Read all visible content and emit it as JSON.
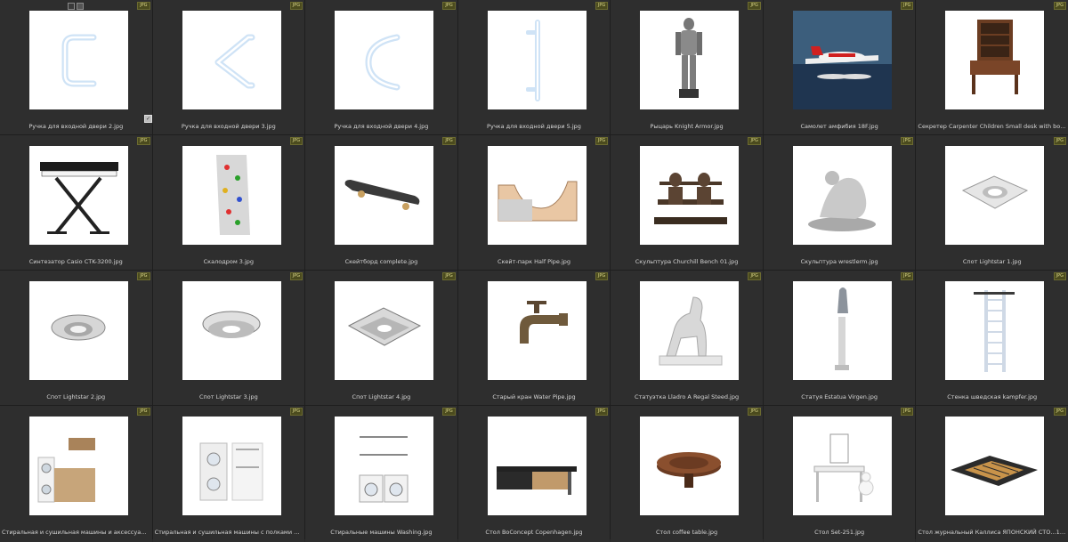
{
  "badge_label": "JPG",
  "items": [
    {
      "name": "Ручка для входной двери 2.jpg",
      "icon": "door-handle-u-icon",
      "selected": true
    },
    {
      "name": "Ручка для входной двери 3.jpg",
      "icon": "door-handle-v-icon"
    },
    {
      "name": "Ручка для входной двери 4.jpg",
      "icon": "door-handle-c-icon"
    },
    {
      "name": "Ручка для входной двери 5.jpg",
      "icon": "door-handle-straight-icon"
    },
    {
      "name": "Рыцарь Knight Armor.jpg",
      "icon": "knight-armor-icon"
    },
    {
      "name": "Самолет амфибия 18F.jpg",
      "icon": "seaplane-icon"
    },
    {
      "name": "Секретер Carpenter Children Small desk with bookcase 126...",
      "icon": "desk-bookcase-icon"
    },
    {
      "name": "Синтезатор Casio CTK-3200.jpg",
      "icon": "synthesizer-icon"
    },
    {
      "name": "Скалодром 3.jpg",
      "icon": "climbing-wall-icon"
    },
    {
      "name": "Скейтборд complete.jpg",
      "icon": "skateboard-icon"
    },
    {
      "name": "Скейт-парк Half Pipe.jpg",
      "icon": "half-pipe-icon"
    },
    {
      "name": "Скульптура Churchill Bench 01.jpg",
      "icon": "bench-sculpture-icon"
    },
    {
      "name": "Скульптура wrestlerm.jpg",
      "icon": "wrestlers-sculpture-icon"
    },
    {
      "name": "Спот Lightstar 1.jpg",
      "icon": "spotlight-square-icon"
    },
    {
      "name": "Спот Lightstar 2.jpg",
      "icon": "spotlight-round-icon"
    },
    {
      "name": "Спот Lightstar 3.jpg",
      "icon": "spotlight-crystal-icon"
    },
    {
      "name": "Спот Lightstar 4.jpg",
      "icon": "spotlight-crystal-square-icon"
    },
    {
      "name": "Старый кран Water Pipe.jpg",
      "icon": "water-tap-icon"
    },
    {
      "name": "Статуэтка Lladro A Regal Steed.jpg",
      "icon": "horse-statuette-icon"
    },
    {
      "name": "Статуя Estatua Virgen.jpg",
      "icon": "column-statue-icon"
    },
    {
      "name": "Стенка шведская kampfer.jpg",
      "icon": "wall-bars-icon"
    },
    {
      "name": "Стиральная и сушильная машины и аксессуары Laundry...",
      "icon": "laundry-set-1-icon"
    },
    {
      "name": "Стиральная и сушильная машины с полками Laundry.jpg",
      "icon": "laundry-set-2-icon"
    },
    {
      "name": "Стиральные машины Washing.jpg",
      "icon": "washing-machines-icon"
    },
    {
      "name": "Стол BoConcept Copenhagen.jpg",
      "icon": "desk-table-icon"
    },
    {
      "name": "Стол coffee table.jpg",
      "icon": "coffee-table-icon"
    },
    {
      "name": "Стол Set-251.jpg",
      "icon": "dressing-table-icon"
    },
    {
      "name": "Стол журнальный Каллиса ЯПОНСКИЙ СТО...10.jpg",
      "icon": "japanese-table-icon"
    }
  ]
}
